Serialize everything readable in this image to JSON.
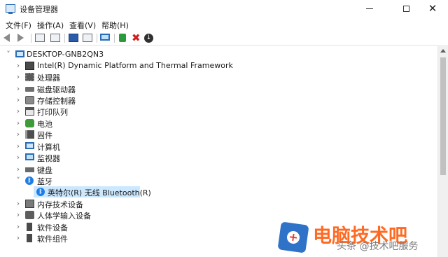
{
  "window": {
    "title": "设备管理器",
    "controls": {
      "minimize": "minimize",
      "maximize": "maximize",
      "close": "✕"
    }
  },
  "menu": [
    "文件(F)",
    "操作(A)",
    "查看(V)",
    "帮助(H)"
  ],
  "toolbar": {
    "icons": [
      "back-arrow-icon",
      "forward-arrow-icon",
      "properties-icon",
      "update-driver-icon",
      "help-icon",
      "scan-icon",
      "monitor-icon",
      "add-driver-icon",
      "uninstall-icon",
      "download-icon"
    ],
    "uninstall_glyph": "✖",
    "download_glyph": "↓"
  },
  "tree": {
    "root": {
      "label": "DESKTOP-GNB2QN3",
      "expanded": true,
      "toggle_glyph": "˅"
    },
    "expanded_glyph": "˅",
    "collapsed_glyph": "›",
    "items": [
      {
        "label": "Intel(R) Dynamic Platform and Thermal Framework",
        "icon": "chip-icon",
        "expanded": false
      },
      {
        "label": "处理器",
        "icon": "cpu-icon",
        "expanded": false
      },
      {
        "label": "磁盘驱动器",
        "icon": "disk-icon",
        "expanded": false
      },
      {
        "label": "存储控制器",
        "icon": "storage-controller-icon",
        "expanded": false
      },
      {
        "label": "打印队列",
        "icon": "printer-icon",
        "expanded": false
      },
      {
        "label": "电池",
        "icon": "battery-icon",
        "expanded": false
      },
      {
        "label": "固件",
        "icon": "firmware-icon",
        "expanded": false
      },
      {
        "label": "计算机",
        "icon": "computer-icon",
        "expanded": false
      },
      {
        "label": "监视器",
        "icon": "monitor-icon",
        "expanded": false
      },
      {
        "label": "键盘",
        "icon": "keyboard-icon",
        "expanded": false
      },
      {
        "label": "蓝牙",
        "icon": "bluetooth-icon",
        "expanded": true,
        "children": [
          {
            "label": "英特尔(R) 无线 Bluetooth(R)",
            "icon": "bluetooth-icon",
            "selected": true
          }
        ]
      },
      {
        "label": "内存技术设备",
        "icon": "memory-device-icon",
        "expanded": false
      },
      {
        "label": "人体学输入设备",
        "icon": "hid-icon",
        "expanded": false
      },
      {
        "label": "软件设备",
        "icon": "software-device-icon",
        "expanded": false
      },
      {
        "label": "软件组件",
        "icon": "software-component-icon",
        "expanded": false
      }
    ]
  },
  "bluetooth_glyph": "ᛒ",
  "colors": {
    "selection": "#cce8ff",
    "accent_blue": "#2a6db5",
    "watermark_orange": "#ff6a22"
  },
  "watermark": {
    "main_text": "电脑技术吧",
    "sub_text": "头条 @技术吧服务",
    "logo_glyph": "+"
  }
}
